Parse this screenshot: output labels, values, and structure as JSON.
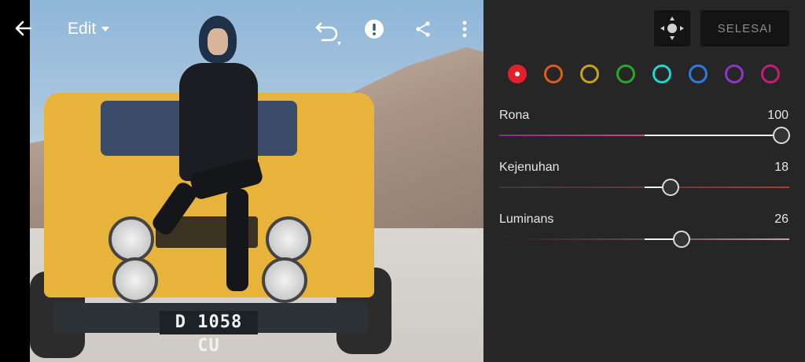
{
  "toolbar": {
    "back_icon": "arrow-left-icon",
    "mode_label": "Edit",
    "mode_icon": "caret-down-icon",
    "undo_icon": "undo-icon",
    "warning_icon": "exclamation-icon",
    "share_icon": "share-icon",
    "more_icon": "more-vertical-icon"
  },
  "photo": {
    "plate_text": "D 1058 CU"
  },
  "panel": {
    "target_tool_icon": "target-adjust-icon",
    "done_label": "SELESAI",
    "swatches": [
      {
        "name": "red",
        "color": "#e0202a",
        "selected": true
      },
      {
        "name": "orange",
        "color": "#e35a1d",
        "selected": false
      },
      {
        "name": "yellow",
        "color": "#c9a21c",
        "selected": false
      },
      {
        "name": "green",
        "color": "#27a82b",
        "selected": false
      },
      {
        "name": "aqua",
        "color": "#1fd6d0",
        "selected": false
      },
      {
        "name": "blue",
        "color": "#2a7be4",
        "selected": false
      },
      {
        "name": "purple",
        "color": "#8a38c8",
        "selected": false
      },
      {
        "name": "magenta",
        "color": "#c21e77",
        "selected": false
      }
    ],
    "sliders": [
      {
        "label": "Rona",
        "value": "100",
        "fraction": 1.0
      },
      {
        "label": "Kejenuhan",
        "value": "18",
        "fraction": 0.59
      },
      {
        "label": "Luminans",
        "value": "26",
        "fraction": 0.63
      }
    ]
  }
}
